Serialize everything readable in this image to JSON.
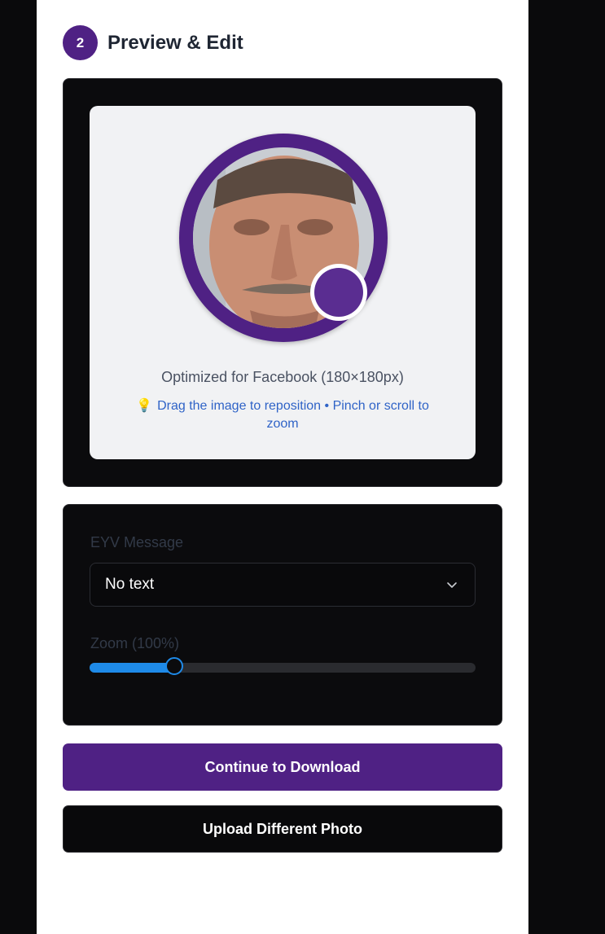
{
  "step": {
    "number": "2",
    "title": "Preview & Edit"
  },
  "preview": {
    "optimized_text": "Optimized for Facebook (180×180px)",
    "hint_icon": "💡",
    "hint_text": "Drag the image to reposition • Pinch or scroll to zoom",
    "photo_icon": "profile-photo",
    "badge_icon": "eyv-voice-badge"
  },
  "controls": {
    "message_label": "EYV Message",
    "message_value": "No text",
    "zoom_label": "Zoom (100%)",
    "zoom_fraction": 0.22
  },
  "buttons": {
    "continue_label": "Continue to Download",
    "upload_label": "Upload Different Photo"
  },
  "colors": {
    "brand_purple": "#4f2184",
    "slider_blue": "#1e8ae8",
    "hint_blue": "#2f63c7"
  }
}
